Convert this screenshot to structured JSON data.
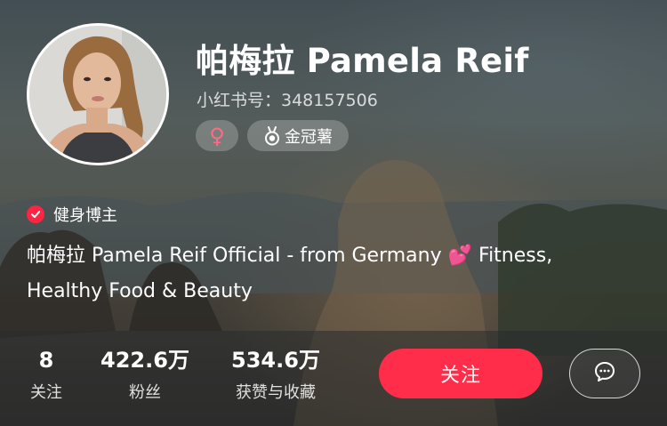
{
  "profile": {
    "name": "帕梅拉 Pamela Reif",
    "id_text": "小红书号：348157506",
    "gender_symbol": "♀",
    "award_label": "金冠薯",
    "verification_label": "健身博主",
    "bio_line1": "帕梅拉 Pamela Reif Official - from Germany",
    "bio_emoji": "💕",
    "bio_line1_end": "Fitness,",
    "bio_line2": "Healthy Food & Beauty"
  },
  "stats": [
    {
      "value": "8",
      "label": "关注"
    },
    {
      "value": "422.6万",
      "label": "粉丝"
    },
    {
      "value": "534.6万",
      "label": "获赞与收藏"
    }
  ],
  "actions": {
    "follow_label": "关注"
  },
  "icons": {
    "message": "chat-bubble-icon",
    "award": "medal-icon",
    "verification": "verified-check-icon",
    "gender": "female-icon"
  },
  "colors": {
    "accent": "#ff2d4a",
    "gender": "#ff6b84"
  }
}
